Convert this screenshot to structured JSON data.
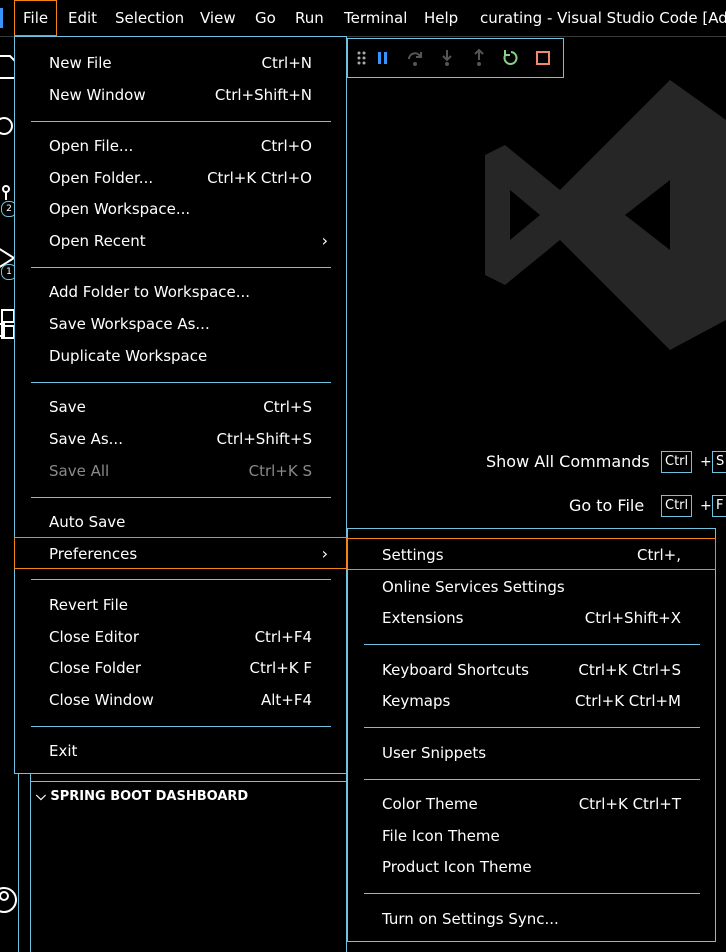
{
  "menubar": {
    "items": [
      "File",
      "Edit",
      "Selection",
      "View",
      "Go",
      "Run",
      "Terminal",
      "Help"
    ],
    "title": "curating - Visual Studio Code [Admin"
  },
  "activity": {
    "badges": [
      "2",
      "1"
    ]
  },
  "file_menu": {
    "items": [
      {
        "label": "New File",
        "shortcut": "Ctrl+N"
      },
      {
        "label": "New Window",
        "shortcut": "Ctrl+Shift+N"
      },
      {
        "label": "Open File...",
        "shortcut": "Ctrl+O"
      },
      {
        "label": "Open Folder...",
        "shortcut": "Ctrl+K Ctrl+O"
      },
      {
        "label": "Open Workspace...",
        "shortcut": ""
      },
      {
        "label": "Open Recent",
        "shortcut": ""
      },
      {
        "label": "Add Folder to Workspace...",
        "shortcut": ""
      },
      {
        "label": "Save Workspace As...",
        "shortcut": ""
      },
      {
        "label": "Duplicate Workspace",
        "shortcut": ""
      },
      {
        "label": "Save",
        "shortcut": "Ctrl+S"
      },
      {
        "label": "Save As...",
        "shortcut": "Ctrl+Shift+S"
      },
      {
        "label": "Save All",
        "shortcut": "Ctrl+K S"
      },
      {
        "label": "Auto Save",
        "shortcut": ""
      },
      {
        "label": "Preferences",
        "shortcut": ""
      },
      {
        "label": "Revert File",
        "shortcut": ""
      },
      {
        "label": "Close Editor",
        "shortcut": "Ctrl+F4"
      },
      {
        "label": "Close Folder",
        "shortcut": "Ctrl+K F"
      },
      {
        "label": "Close Window",
        "shortcut": "Alt+F4"
      },
      {
        "label": "Exit",
        "shortcut": ""
      }
    ]
  },
  "prefs_menu": {
    "items": [
      {
        "label": "Settings",
        "shortcut": "Ctrl+,"
      },
      {
        "label": "Online Services Settings",
        "shortcut": ""
      },
      {
        "label": "Extensions",
        "shortcut": "Ctrl+Shift+X"
      },
      {
        "label": "Keyboard Shortcuts",
        "shortcut": "Ctrl+K Ctrl+S"
      },
      {
        "label": "Keymaps",
        "shortcut": "Ctrl+K Ctrl+M"
      },
      {
        "label": "User Snippets",
        "shortcut": ""
      },
      {
        "label": "Color Theme",
        "shortcut": "Ctrl+K Ctrl+T"
      },
      {
        "label": "File Icon Theme",
        "shortcut": ""
      },
      {
        "label": "Product Icon Theme",
        "shortcut": ""
      },
      {
        "label": "Turn on Settings Sync...",
        "shortcut": ""
      }
    ]
  },
  "sidebar": {
    "spring_title": "SPRING BOOT DASHBOARD"
  },
  "editor": {
    "hints": [
      {
        "label": "Show All Commands",
        "key1": "Ctrl",
        "key2": "S"
      },
      {
        "label": "Go to File",
        "key1": "Ctrl",
        "key2": "F"
      }
    ],
    "plus": "+"
  },
  "colors": {
    "accent_border": "#6fc3df",
    "focus_border": "#f38518",
    "debug_continue": "#3794ff",
    "debug_restart": "#89d185",
    "debug_stop": "#f48771"
  }
}
